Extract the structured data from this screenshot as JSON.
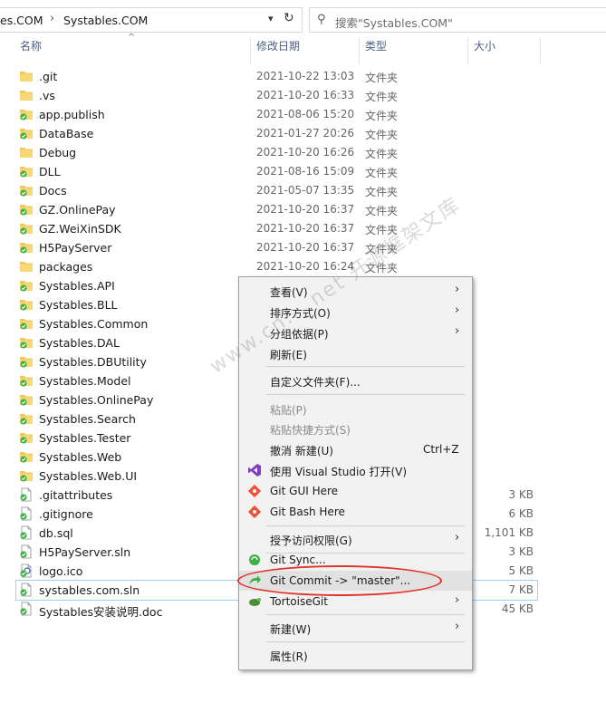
{
  "address": {
    "crumb1": "es.COM",
    "sep": "›",
    "crumb2": "Systables.COM"
  },
  "search": {
    "placeholder": "搜索\"Systables.COM\""
  },
  "columns": {
    "name": "名称",
    "date": "修改日期",
    "type": "类型",
    "size": "大小"
  },
  "files": [
    {
      "name": ".git",
      "date": "2021-10-22 13:03",
      "type": "文件夹",
      "size": "",
      "icon": "folder"
    },
    {
      "name": ".vs",
      "date": "2021-10-20 16:33",
      "type": "文件夹",
      "size": "",
      "icon": "folder"
    },
    {
      "name": "app.publish",
      "date": "2021-08-06 15:20",
      "type": "文件夹",
      "size": "",
      "icon": "folder-git"
    },
    {
      "name": "DataBase",
      "date": "2021-01-27 20:26",
      "type": "文件夹",
      "size": "",
      "icon": "folder-git"
    },
    {
      "name": "Debug",
      "date": "2021-10-20 16:26",
      "type": "文件夹",
      "size": "",
      "icon": "folder"
    },
    {
      "name": "DLL",
      "date": "2021-08-16 15:09",
      "type": "文件夹",
      "size": "",
      "icon": "folder-git"
    },
    {
      "name": "Docs",
      "date": "2021-05-07 13:35",
      "type": "文件夹",
      "size": "",
      "icon": "folder-git"
    },
    {
      "name": "GZ.OnlinePay",
      "date": "2021-10-20 16:37",
      "type": "文件夹",
      "size": "",
      "icon": "folder-git"
    },
    {
      "name": "GZ.WeiXinSDK",
      "date": "2021-10-20 16:37",
      "type": "文件夹",
      "size": "",
      "icon": "folder-git"
    },
    {
      "name": "H5PayServer",
      "date": "2021-10-20 16:37",
      "type": "文件夹",
      "size": "",
      "icon": "folder-git"
    },
    {
      "name": "packages",
      "date": "2021-10-20 16:24",
      "type": "文件夹",
      "size": "",
      "icon": "folder"
    },
    {
      "name": "Systables.API",
      "date": "",
      "type": "",
      "size": "",
      "icon": "folder-git"
    },
    {
      "name": "Systables.BLL",
      "date": "",
      "type": "",
      "size": "",
      "icon": "folder-git"
    },
    {
      "name": "Systables.Common",
      "date": "",
      "type": "",
      "size": "",
      "icon": "folder-git"
    },
    {
      "name": "Systables.DAL",
      "date": "",
      "type": "",
      "size": "",
      "icon": "folder-git"
    },
    {
      "name": "Systables.DBUtility",
      "date": "",
      "type": "",
      "size": "",
      "icon": "folder-git"
    },
    {
      "name": "Systables.Model",
      "date": "",
      "type": "",
      "size": "",
      "icon": "folder-git"
    },
    {
      "name": "Systables.OnlinePay",
      "date": "",
      "type": "",
      "size": "",
      "icon": "folder-git"
    },
    {
      "name": "Systables.Search",
      "date": "",
      "type": "",
      "size": "",
      "icon": "folder-git"
    },
    {
      "name": "Systables.Tester",
      "date": "",
      "type": "",
      "size": "",
      "icon": "folder-git"
    },
    {
      "name": "Systables.Web",
      "date": "",
      "type": "",
      "size": "",
      "icon": "folder-git"
    },
    {
      "name": "Systables.Web.UI",
      "date": "",
      "type": "",
      "size": "",
      "icon": "folder-git"
    },
    {
      "name": ".gitattributes",
      "date": "",
      "type": "",
      "size": "3 KB",
      "icon": "file-git"
    },
    {
      "name": ".gitignore",
      "date": "",
      "type": "",
      "size": "6 KB",
      "icon": "file-git"
    },
    {
      "name": "db.sql",
      "date": "",
      "type": "",
      "size": "1,101 KB",
      "icon": "file-git"
    },
    {
      "name": "H5PayServer.sln",
      "date": "",
      "type": "",
      "size": "3 KB",
      "icon": "file-git"
    },
    {
      "name": "logo.ico",
      "date": "",
      "type": "",
      "size": "5 KB",
      "icon": "file-git-ico"
    },
    {
      "name": "systables.com.sln",
      "date": "",
      "type": "",
      "size": "7 KB",
      "icon": "file-git"
    },
    {
      "name": "Systables安装说明.doc",
      "date": "",
      "type": "",
      "size": "45 KB",
      "icon": "file-git"
    }
  ],
  "menu": {
    "view": "查看(V)",
    "sort": "排序方式(O)",
    "group": "分组依据(P)",
    "refresh": "刷新(E)",
    "customize": "自定义文件夹(F)...",
    "paste": "粘贴(P)",
    "paste_shortcut": "粘贴快捷方式(S)",
    "undo": "撤消 新建(U)",
    "undo_shortcut": "Ctrl+Z",
    "open_vs": "使用 Visual Studio 打开(V)",
    "git_gui": "Git GUI Here",
    "git_bash": "Git Bash Here",
    "grant_access": "授予访问权限(G)",
    "git_sync": "Git Sync...",
    "git_commit": "Git Commit -> \"master\"...",
    "tortoise": "TortoiseGit",
    "new": "新建(W)",
    "properties": "属性(R)"
  },
  "watermark": "www.cn... net 开源框架文库",
  "colors": {
    "folder": "#f2c55c",
    "git_ok": "#3cb043",
    "accent": "#e0342c"
  }
}
